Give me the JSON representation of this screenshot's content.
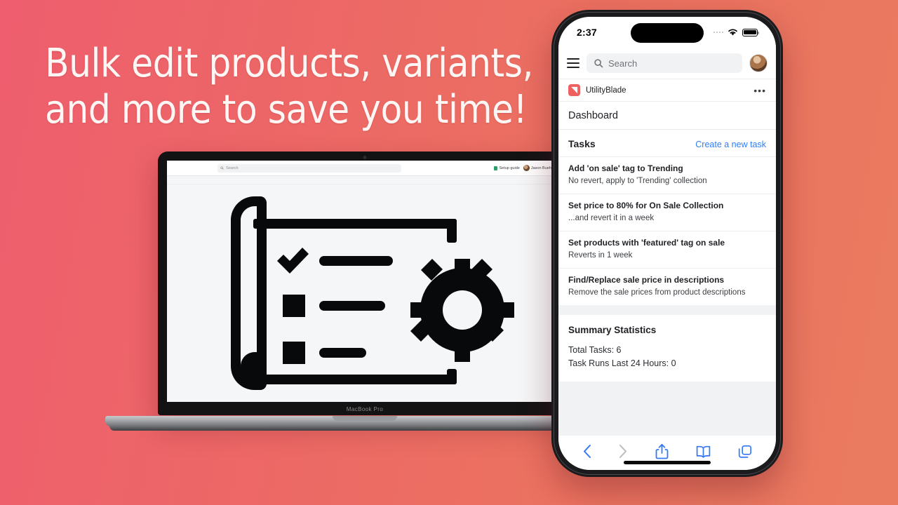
{
  "background": {
    "from": "#ee5e6e",
    "to": "#ea7b60"
  },
  "headline": "Bulk edit products, variants,\nand more to save you time!",
  "laptop": {
    "model_label": "MacBook Pro",
    "topbar": {
      "search_placeholder": "Search",
      "setup_guide_label": "Setup guide",
      "user_name": "Jason Buehler"
    },
    "illustration_name": "checklist-document-with-gear"
  },
  "phone": {
    "statusbar": {
      "time": "2:37",
      "wifi": "wifi-icon",
      "battery": "battery-icon",
      "signal": "signal-dots-icon"
    },
    "browser": {
      "menu": "hamburger-menu-icon",
      "search_placeholder": "Search",
      "avatar": "user-avatar"
    },
    "app_row": {
      "app_name": "UtilityBlade",
      "overflow": "•••",
      "icon_color": "#ef6161"
    },
    "page_title": "Dashboard",
    "tasks_card": {
      "title": "Tasks",
      "action_label": "Create a new task",
      "link_color": "#2d7ff9",
      "items": [
        {
          "title": "Add 'on sale' tag to Trending",
          "subtitle": "No revert, apply to 'Trending' collection"
        },
        {
          "title": "Set price to 80% for On Sale Collection",
          "subtitle": "...and revert it in a week"
        },
        {
          "title": "Set products with 'featured' tag on sale",
          "subtitle": "Reverts in 1 week"
        },
        {
          "title": "Find/Replace sale price in descriptions",
          "subtitle": "Remove the sale prices from product descriptions"
        }
      ]
    },
    "summary_card": {
      "title": "Summary Statistics",
      "lines": [
        "Total Tasks: 6",
        "Task Runs Last 24 Hours: 0"
      ]
    },
    "toolbar": {
      "back": "back-chevron-icon",
      "forward": "forward-chevron-icon",
      "share": "share-icon",
      "bookmarks": "bookmarks-icon",
      "tabs": "tabs-icon"
    }
  }
}
